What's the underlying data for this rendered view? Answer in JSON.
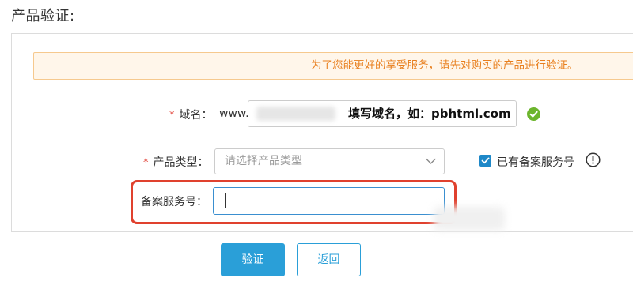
{
  "page": {
    "title": "产品验证:"
  },
  "notice": {
    "text": "为了您能更好的享受服务，请先对购买的产品进行验证。"
  },
  "form": {
    "required_mark": "*",
    "domain": {
      "label": "域名：",
      "prefix": "www.",
      "hint": "填写域名，如：pbhtml.com",
      "status_icon": "check-circle-icon"
    },
    "product_type": {
      "label": "产品类型：",
      "placeholder": "请选择产品类型"
    },
    "has_record": {
      "label": "已有备案服务号",
      "checked": true,
      "info_icon": "info-icon"
    },
    "record_number": {
      "label": "备案服务号：",
      "value": ""
    }
  },
  "buttons": {
    "verify": "验证",
    "back": "返回"
  },
  "colors": {
    "accent": "#2a9fd8",
    "warning_text": "#e87e1c",
    "warning_bg": "#fff6ea",
    "success": "#6cb52d",
    "required": "#e03c31",
    "highlight": "#e0412e"
  }
}
